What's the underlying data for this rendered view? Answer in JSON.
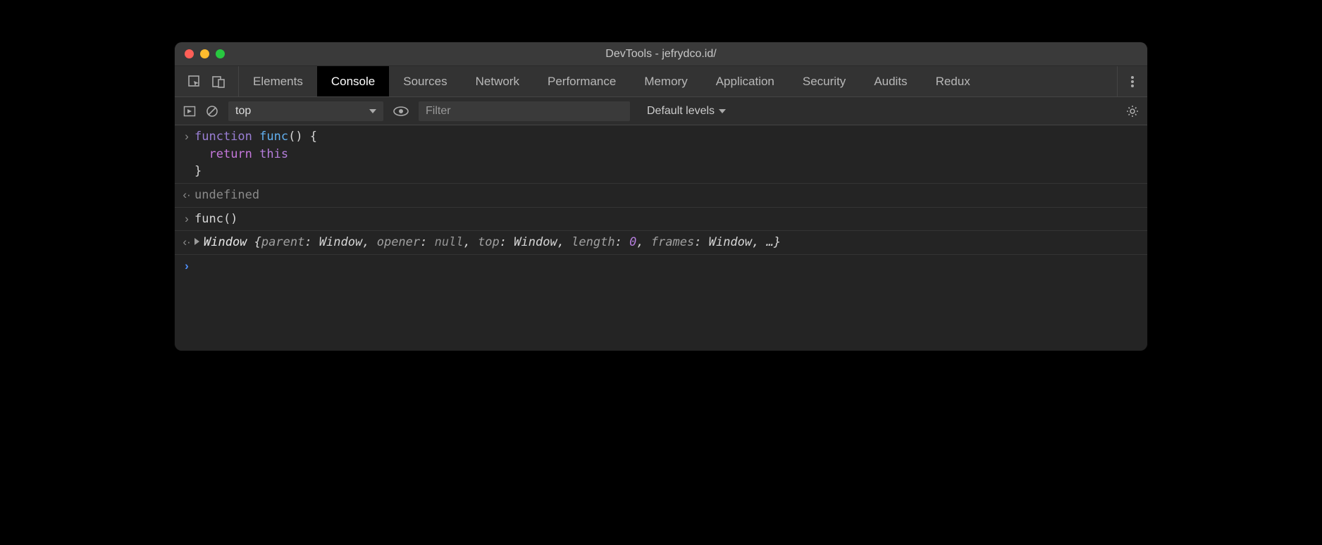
{
  "window": {
    "title": "DevTools - jefrydco.id/"
  },
  "tabs": {
    "items": [
      "Elements",
      "Console",
      "Sources",
      "Network",
      "Performance",
      "Memory",
      "Application",
      "Security",
      "Audits",
      "Redux"
    ],
    "active": "Console"
  },
  "toolbar": {
    "context": "top",
    "filter_placeholder": "Filter",
    "levels_label": "Default levels"
  },
  "console": {
    "entries": [
      {
        "marker": "input",
        "code": {
          "line1_kw": "function",
          "line1_name": "func",
          "line1_rest": "() {",
          "line2_kw": "return",
          "line2_this": "this",
          "line3": "}"
        }
      },
      {
        "marker": "output",
        "text": "undefined"
      },
      {
        "marker": "input",
        "call": "func()"
      },
      {
        "marker": "output",
        "object": {
          "head": "Window",
          "props": [
            {
              "k": "parent",
              "v": "Window",
              "t": "obj"
            },
            {
              "k": "opener",
              "v": "null",
              "t": "null"
            },
            {
              "k": "top",
              "v": "Window",
              "t": "obj"
            },
            {
              "k": "length",
              "v": "0",
              "t": "num"
            },
            {
              "k": "frames",
              "v": "Window",
              "t": "obj"
            }
          ],
          "tail": ", …}"
        }
      }
    ],
    "prompt_marker": "›"
  }
}
